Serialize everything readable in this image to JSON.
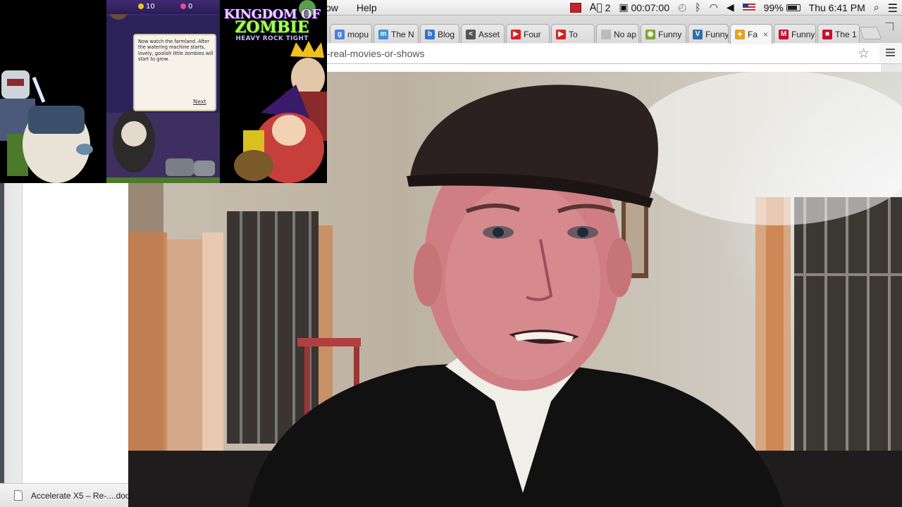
{
  "menubar": {
    "items": [
      "ow",
      "Help"
    ],
    "status": {
      "input_badge": "2",
      "timer": "00:07:00",
      "battery_pct": "99%",
      "clock": "Thu 6:41 PM"
    }
  },
  "tabs": [
    {
      "label": "mopu",
      "color": "#4a7fe0",
      "glyph": "g"
    },
    {
      "label": "The N",
      "color": "#3b95d6",
      "glyph": "m"
    },
    {
      "label": "Blog",
      "color": "#2f74d0",
      "glyph": "b"
    },
    {
      "label": "Asset",
      "color": "#555555",
      "glyph": "<"
    },
    {
      "label": "Four",
      "color": "#d62020",
      "glyph": "▶"
    },
    {
      "label": "To",
      "color": "#d62020",
      "glyph": "▶"
    },
    {
      "label": "No ap",
      "color": "#bbbbbb",
      "glyph": ""
    },
    {
      "label": "Funny",
      "color": "#7aa33a",
      "glyph": "◉"
    },
    {
      "label": "Funny",
      "color": "#2f6fa8",
      "glyph": "V"
    },
    {
      "label": "Fa",
      "color": "#e8a020",
      "glyph": "✦"
    },
    {
      "label": "Funny",
      "color": "#c8102e",
      "glyph": "M"
    },
    {
      "label": "The 1",
      "color": "#c8102e",
      "glyph": "■"
    }
  ],
  "toolbar": {
    "url": "-real-movies-or-shows"
  },
  "download_shelf": {
    "label": "Accelerate X5 – Re-....doc"
  },
  "game_ad": {
    "logo_line1": "KINGDOM OF",
    "logo_line2": "ZOMBIE",
    "logo_line3": "HEAVY ROCK TIGHT",
    "coins": "10",
    "gems": "0",
    "dialog_text": "Now watch the farmland. After the watering machine starts, lovely, goolish little zombies will start to grow.",
    "next_label": "Next"
  }
}
